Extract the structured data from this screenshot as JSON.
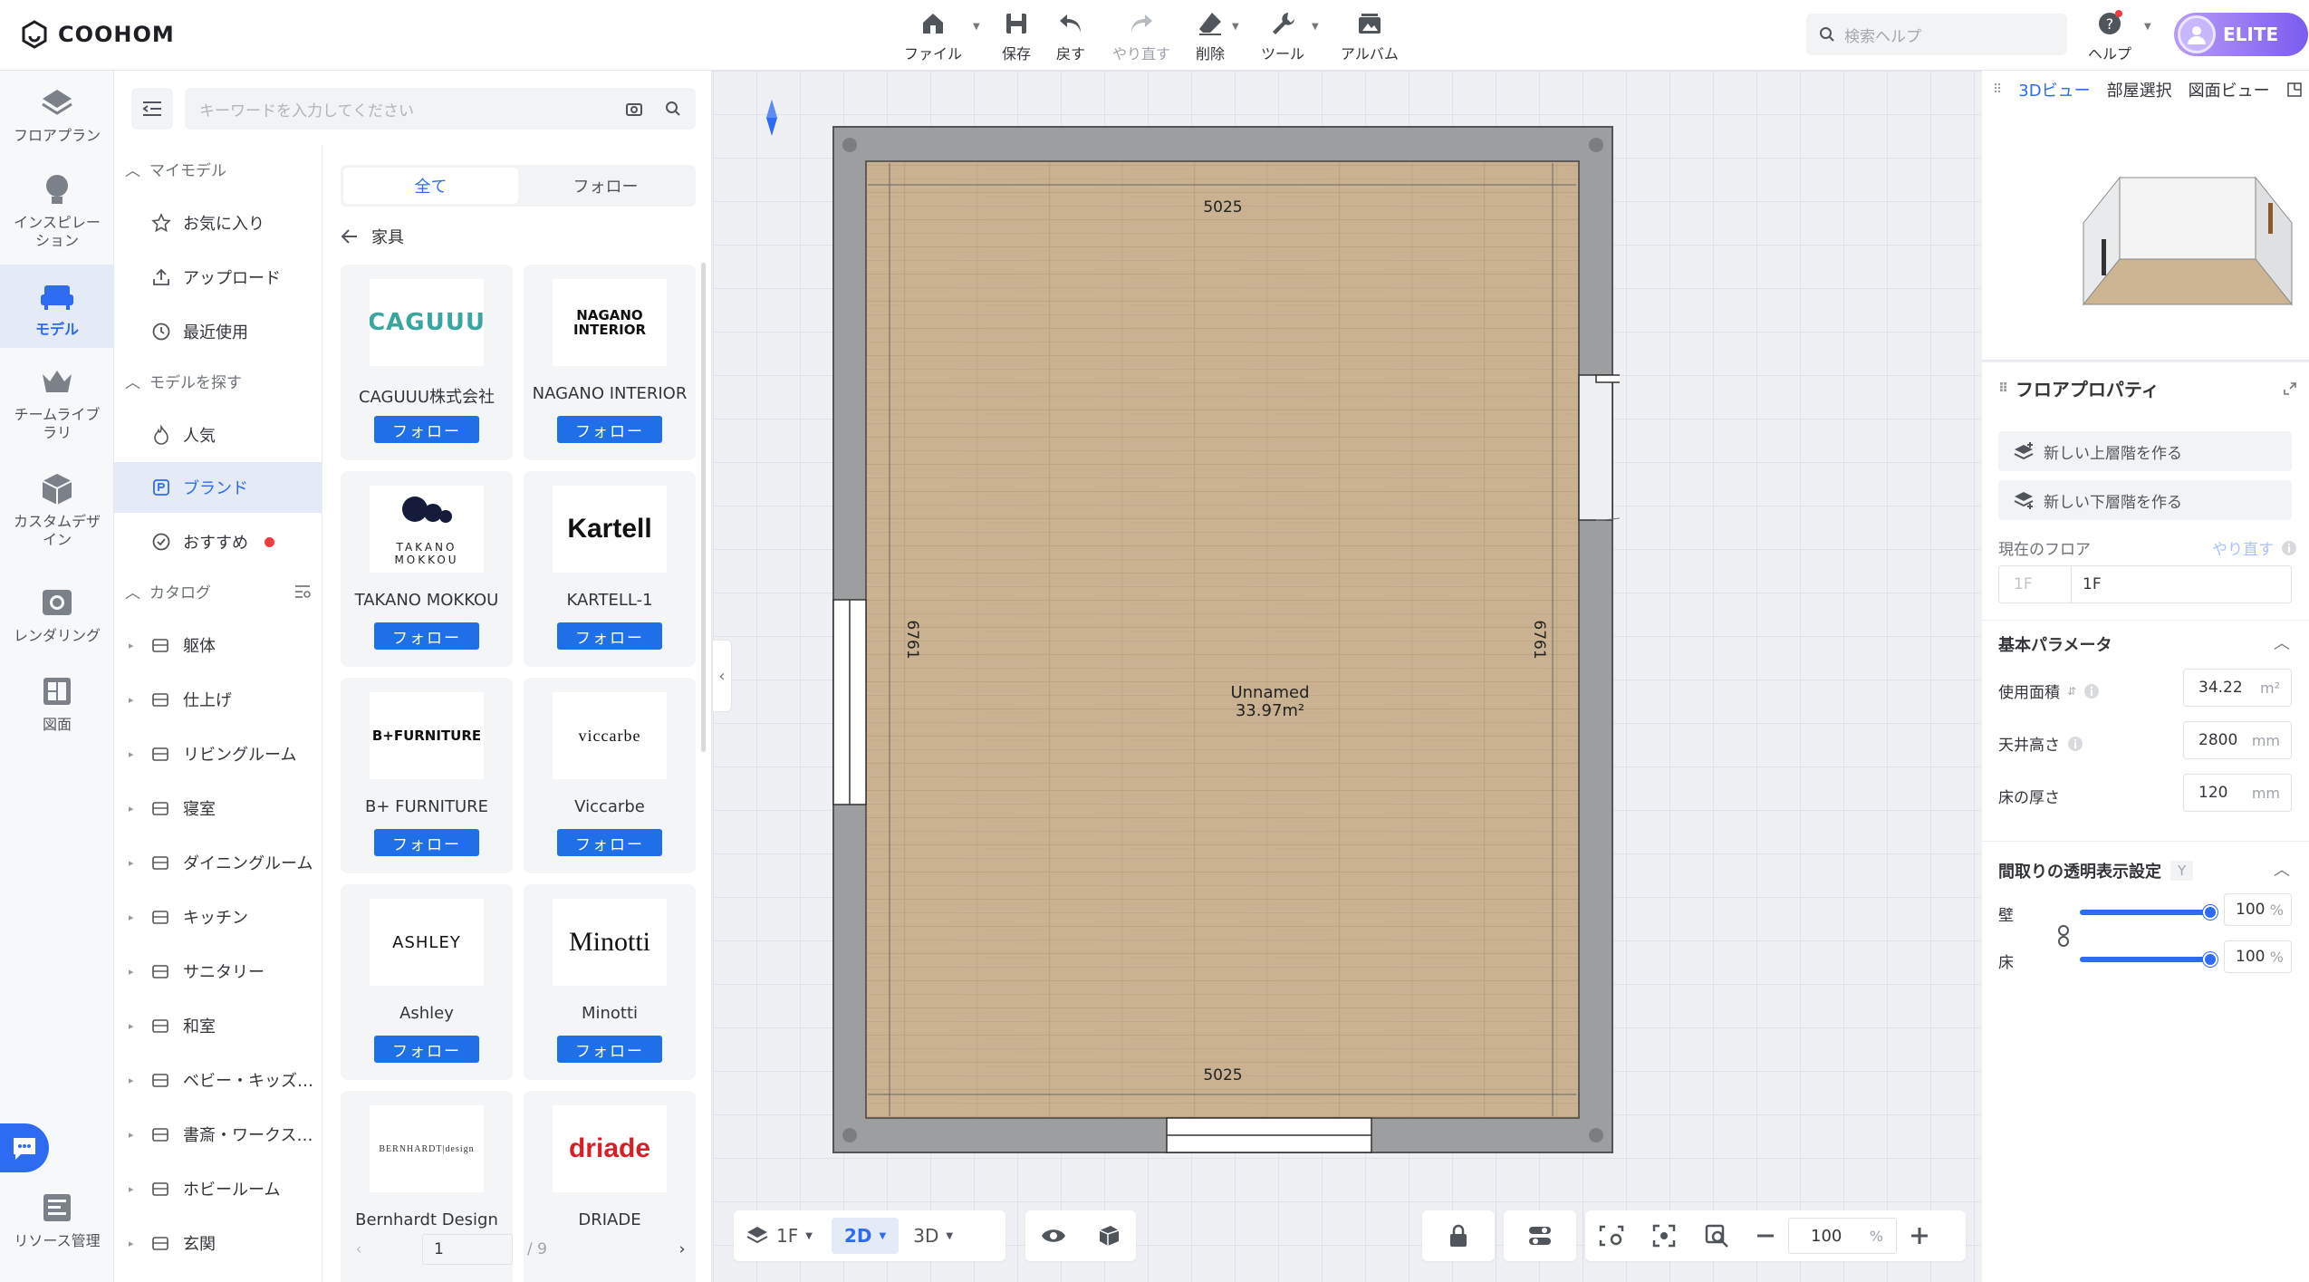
{
  "app": {
    "logo_text": "COOHOM"
  },
  "toolbar": {
    "file": "ファイル",
    "save": "保存",
    "undo": "戻す",
    "redo": "やり直す",
    "delete": "削除",
    "tools": "ツール",
    "album": "アルバム"
  },
  "help_search": {
    "placeholder": "検索ヘルプ"
  },
  "help": {
    "label": "ヘルプ"
  },
  "account": {
    "badge": "ELITE"
  },
  "leftnav": {
    "items": [
      {
        "label": "フロアプラン",
        "icon": "floorplan-icon"
      },
      {
        "label": "インスピレーション",
        "icon": "bulb-icon"
      },
      {
        "label": "モデル",
        "icon": "sofa-icon"
      },
      {
        "label": "チームライブラリ",
        "icon": "crown-icon"
      },
      {
        "label": "カスタムデザイン",
        "icon": "box-icon"
      },
      {
        "label": "レンダリング",
        "icon": "camera-icon"
      },
      {
        "label": "図面",
        "icon": "drawing-icon"
      },
      {
        "label": "リソース管理",
        "icon": "resource-icon"
      }
    ]
  },
  "search": {
    "placeholder": "キーワードを入力してください"
  },
  "categories": {
    "my_models": "マイモデル",
    "favorites": "お気に入り",
    "upload": "アップロード",
    "recent": "最近使用",
    "find_models": "モデルを探す",
    "popular": "人気",
    "brand": "ブランド",
    "recommended": "おすすめ",
    "catalog": "カタログ",
    "catalog_items": [
      "躯体",
      "仕上げ",
      "リビングルーム",
      "寝室",
      "ダイニングルーム",
      "キッチン",
      "サニタリー",
      "和室",
      "ベビー・キッズ…",
      "書斎・ワークス…",
      "ホビールーム",
      "玄関"
    ]
  },
  "tabs": {
    "all": "全て",
    "follow": "フォロー"
  },
  "breadcrumb": {
    "label": "家具"
  },
  "brands": {
    "follow_label": "フォロー",
    "items": [
      {
        "name": "CAGUUU株式会社",
        "logo": "CAGUUU"
      },
      {
        "name": "NAGANO INTERIOR",
        "logo": "NAGANO INTERIOR"
      },
      {
        "name": "TAKANO MOKKOU",
        "logo": "TAKANO MOKKOU"
      },
      {
        "name": "KARTELL-1",
        "logo": "Kartell"
      },
      {
        "name": "B+ FURNITURE",
        "logo": "B+FURNITURE"
      },
      {
        "name": "Viccarbe",
        "logo": "viccarbe"
      },
      {
        "name": "Ashley",
        "logo": "ASHLEY"
      },
      {
        "name": "Minotti",
        "logo": "Minotti"
      },
      {
        "name": "Bernhardt Design",
        "logo": "BERNHARDT|design"
      },
      {
        "name": "DRIADE",
        "logo": "driade"
      }
    ]
  },
  "pager": {
    "current": "1",
    "total": "/ 9"
  },
  "room": {
    "name": "Unnamed",
    "area": "33.97m²",
    "dim_top": "5025",
    "dim_bottom": "5025",
    "dim_left": "6761",
    "dim_right": "6761"
  },
  "bottom": {
    "floor": "1F",
    "mode_2d": "2D",
    "mode_3d": "3D",
    "zoom": "100",
    "zoom_unit": "%"
  },
  "right": {
    "tab_3d": "3Dビュー",
    "tab_room": "部屋選択",
    "tab_plan": "図面ビュー",
    "prop_title": "フロアプロパティ",
    "new_upper": "新しい上層階を作る",
    "new_lower": "新しい下層階を作る",
    "current_floor": "現在のフロア",
    "redo": "やり直す",
    "floor_prefix": "1F",
    "floor_value": "1F",
    "basic_params": "基本パラメータ",
    "usable_area": "使用面積",
    "usable_area_value": "34.22",
    "usable_area_unit": "m²",
    "ceiling_height": "天井高さ",
    "ceiling_height_value": "2800",
    "ceiling_unit": "mm",
    "floor_thickness": "床の厚さ",
    "floor_thickness_value": "120",
    "floor_unit": "mm",
    "transparency": "間取りの透明表示設定",
    "transparency_key": "Y",
    "wall": "壁",
    "wall_value": "100",
    "floor": "床",
    "floor_opacity_value": "100",
    "pct": "%"
  }
}
